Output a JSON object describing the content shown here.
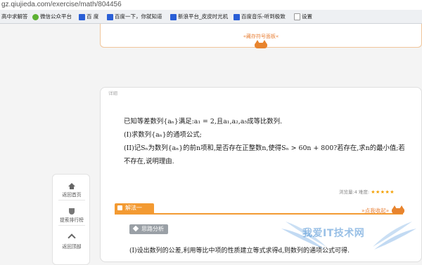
{
  "browser": {
    "url": "gz.qiujieda.com/exercise/math/804456",
    "bookmarks": [
      {
        "label": "高中求解答",
        "icon": "none"
      },
      {
        "label": "微信公众平台",
        "icon": "wechat-icon"
      },
      {
        "label": "百 度",
        "icon": "baidu-icon"
      },
      {
        "label": "百度一下，你就知道",
        "icon": "baidu-icon"
      },
      {
        "label": "新浪平台_皮皮时光机",
        "icon": "baidu-icon"
      },
      {
        "label": "百度音乐-听到极致",
        "icon": "baidu-icon"
      },
      {
        "label": "设置",
        "icon": "page-icon"
      }
    ]
  },
  "top_panel": {
    "collapse_label": "«藏存符号面板«"
  },
  "detail": {
    "tag": "详細",
    "problem_lines": [
      "已知等差数列{aₙ}满足:a₁ = 2,且a₁,a₂,a₅成等比数列.",
      "(I)求数列{aₙ}的通项公式;",
      "(II)记Sₙ为数列{aₙ}的前n项和,是否存在正整数n,使得Sₙ > 60n + 800?若存在,求n的最小值;若",
      "不存在,说明理由."
    ],
    "views_label": "浏览量:4",
    "difficulty_label": "难度:",
    "stars": "★★★★★"
  },
  "solution": {
    "tab_label": "解法一",
    "fold_label": "»点我收起»",
    "analysis_label": "思路分析",
    "step_text": "(I)设出数列的公差,利用等比中项的性质建立等式求得d,则数列的通项公式可得."
  },
  "sidenav": {
    "items": [
      {
        "label": "返回首页",
        "icon": "home-icon"
      },
      {
        "label": "提索排行榜",
        "icon": "trophy-icon"
      },
      {
        "label": "返回顶部",
        "icon": "chevron-up-icon"
      }
    ]
  },
  "watermark": {
    "text": "我爱IT技术网"
  },
  "colors": {
    "accent": "#f39a32",
    "panel_border": "#f0c59a",
    "star": "#f3a000",
    "tag_gray": "#9aa0a6"
  }
}
